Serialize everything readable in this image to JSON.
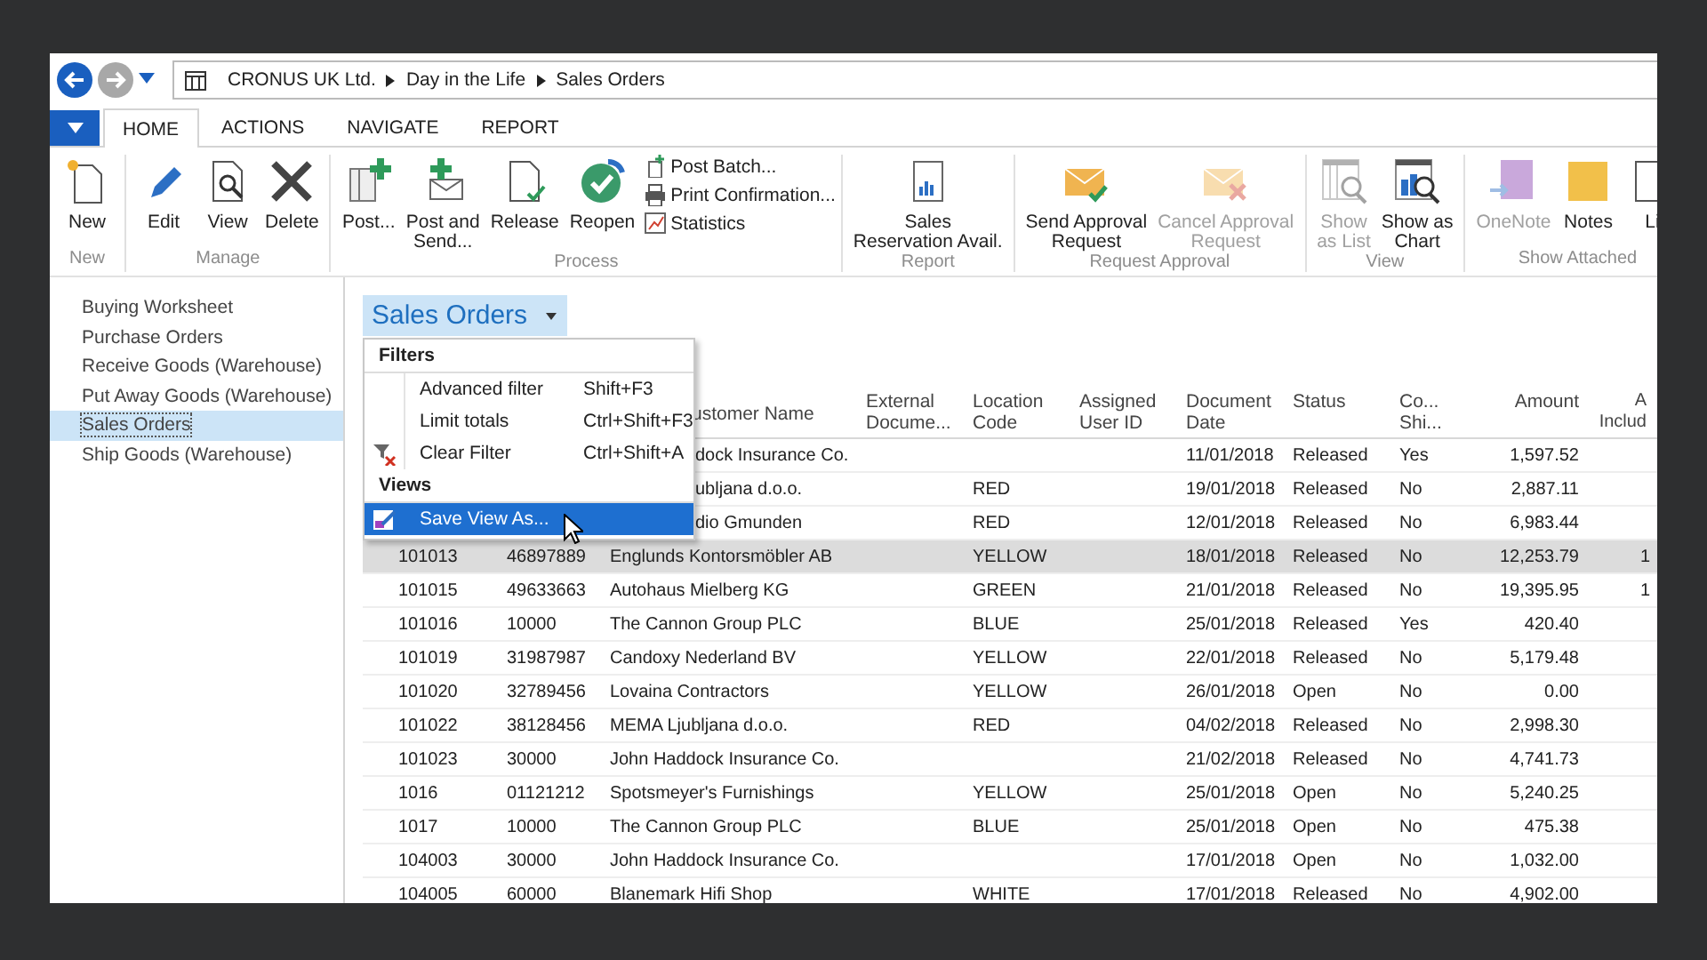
{
  "address_bar": {
    "breadcrumb": [
      "CRONUS UK Ltd.",
      "Day in the Life",
      "Sales Orders"
    ]
  },
  "ribbon_tabs": [
    {
      "label": "HOME",
      "selected": true
    },
    {
      "label": "ACTIONS",
      "selected": false
    },
    {
      "label": "NAVIGATE",
      "selected": false
    },
    {
      "label": "REPORT",
      "selected": false
    }
  ],
  "ribbon_groups": [
    {
      "label": "New",
      "buttons": [
        {
          "kind": "new",
          "lines": [
            "New"
          ],
          "disabled": false
        }
      ]
    },
    {
      "label": "Manage",
      "buttons": [
        {
          "kind": "edit",
          "lines": [
            "Edit"
          ],
          "disabled": false
        },
        {
          "kind": "view",
          "lines": [
            "View"
          ],
          "disabled": false
        },
        {
          "kind": "delete",
          "lines": [
            "Delete"
          ],
          "disabled": false
        }
      ]
    },
    {
      "label": "Process",
      "buttons": [
        {
          "kind": "post",
          "lines": [
            "Post..."
          ],
          "disabled": false
        },
        {
          "kind": "postsend",
          "lines": [
            "Post and",
            "Send..."
          ],
          "disabled": false
        },
        {
          "kind": "release",
          "lines": [
            "Release"
          ],
          "disabled": false
        },
        {
          "kind": "reopen",
          "lines": [
            "Reopen"
          ],
          "disabled": false
        }
      ],
      "small": [
        {
          "kind": "batch",
          "label": "Post Batch..."
        },
        {
          "kind": "print",
          "label": "Print Confirmation..."
        },
        {
          "kind": "statistics",
          "label": "Statistics"
        }
      ]
    },
    {
      "label": "Report",
      "buttons": [
        {
          "kind": "report",
          "lines": [
            "Sales",
            "Reservation Avail."
          ],
          "disabled": false
        }
      ]
    },
    {
      "label": "Request Approval",
      "buttons": [
        {
          "kind": "sendapproval",
          "lines": [
            "Send Approval",
            "Request"
          ],
          "disabled": false
        },
        {
          "kind": "cancelapproval",
          "lines": [
            "Cancel Approval",
            "Request"
          ],
          "disabled": true
        }
      ]
    },
    {
      "label": "View",
      "buttons": [
        {
          "kind": "list",
          "lines": [
            "Show",
            "as List"
          ],
          "disabled": true
        },
        {
          "kind": "chart",
          "lines": [
            "Show as",
            "Chart"
          ],
          "disabled": false
        }
      ]
    },
    {
      "label": "Show Attached",
      "buttons": [
        {
          "kind": "onenote",
          "lines": [
            "OneNote"
          ],
          "disabled": true
        },
        {
          "kind": "notes",
          "lines": [
            "Notes"
          ],
          "disabled": false
        },
        {
          "kind": "links",
          "lines": [
            "Li"
          ],
          "disabled": false
        }
      ]
    }
  ],
  "sidebar": {
    "items": [
      {
        "label": "Buying Worksheet",
        "selected": false
      },
      {
        "label": "Purchase Orders",
        "selected": false
      },
      {
        "label": "Receive Goods (Warehouse)",
        "selected": false
      },
      {
        "label": "Put Away Goods (Warehouse)",
        "selected": false
      },
      {
        "label": "Sales Orders",
        "selected": true
      },
      {
        "label": "Ship Goods (Warehouse)",
        "selected": false
      }
    ]
  },
  "page_title": "Sales Orders",
  "menu": {
    "items": [
      {
        "kind": "header",
        "label": "Filters"
      },
      {
        "kind": "item",
        "label": "Advanced filter",
        "shortcut": "Shift+F3",
        "selected": false
      },
      {
        "kind": "item",
        "label": "Limit totals",
        "shortcut": "Ctrl+Shift+F3",
        "selected": false
      },
      {
        "kind": "clear",
        "label": "Clear Filter",
        "shortcut": "Ctrl+Shift+A",
        "selected": false
      },
      {
        "kind": "header",
        "label": "Views"
      },
      {
        "kind": "save",
        "label": "Save View As...",
        "selected": true
      }
    ]
  },
  "table": {
    "columns": [
      {
        "kind": "partial",
        "lines": [
          "ustomer Name"
        ]
      },
      {
        "kind": "text",
        "lines": [
          "External",
          "Docume..."
        ]
      },
      {
        "kind": "text",
        "lines": [
          "Location",
          "Code"
        ]
      },
      {
        "kind": "text",
        "lines": [
          "Assigned",
          "User ID"
        ]
      },
      {
        "kind": "text",
        "lines": [
          "Document",
          "Date"
        ]
      },
      {
        "kind": "text",
        "lines": [
          "Status"
        ]
      },
      {
        "kind": "text",
        "lines": [
          "Co...",
          "Shi..."
        ]
      },
      {
        "kind": "number",
        "lines": [
          "Amount"
        ]
      },
      {
        "kind": "number",
        "lines": [
          "A",
          "Includ"
        ]
      }
    ],
    "rows": [
      {
        "kind": "partial",
        "selected": false,
        "name": "dock Insurance Co.",
        "date": "11/01/2018",
        "status": "Released",
        "ship": "Yes",
        "amount": "1,597.52"
      },
      {
        "kind": "partial",
        "selected": false,
        "name": "ubljana d.o.o.",
        "location": "RED",
        "date": "19/01/2018",
        "status": "Released",
        "ship": "No",
        "amount": "2,887.11"
      },
      {
        "kind": "partial",
        "selected": false,
        "name": "dio Gmunden",
        "location": "RED",
        "date": "12/01/2018",
        "status": "Released",
        "ship": "No",
        "amount": "6,983.44"
      },
      {
        "kind": "full",
        "selected": true,
        "no": "101013",
        "customer_no": "46897889",
        "name": "Englunds Kontorsmöbler AB",
        "location": "YELLOW",
        "date": "18/01/2018",
        "status": "Released",
        "ship": "No",
        "amount": "12,253.79",
        "column_10": "1"
      },
      {
        "kind": "full",
        "selected": false,
        "no": "101015",
        "customer_no": "49633663",
        "name": "Autohaus Mielberg KG",
        "location": "GREEN",
        "date": "21/01/2018",
        "status": "Released",
        "ship": "No",
        "amount": "19,395.95",
        "column_10": "1"
      },
      {
        "kind": "full",
        "selected": false,
        "no": "101016",
        "customer_no": "10000",
        "name": "The Cannon Group PLC",
        "location": "BLUE",
        "date": "25/01/2018",
        "status": "Released",
        "ship": "Yes",
        "amount": "420.40"
      },
      {
        "kind": "full",
        "selected": false,
        "no": "101019",
        "customer_no": "31987987",
        "name": "Candoxy Nederland BV",
        "location": "YELLOW",
        "date": "22/01/2018",
        "status": "Released",
        "ship": "No",
        "amount": "5,179.48"
      },
      {
        "kind": "full",
        "selected": false,
        "no": "101020",
        "customer_no": "32789456",
        "name": "Lovaina Contractors",
        "location": "YELLOW",
        "date": "26/01/2018",
        "status": "Open",
        "ship": "No",
        "amount": "0.00"
      },
      {
        "kind": "full",
        "selected": false,
        "no": "101022",
        "customer_no": "38128456",
        "name": "MEMA Ljubljana d.o.o.",
        "location": "RED",
        "date": "04/02/2018",
        "status": "Released",
        "ship": "No",
        "amount": "2,998.30"
      },
      {
        "kind": "full",
        "selected": false,
        "no": "101023",
        "customer_no": "30000",
        "name": "John Haddock Insurance Co.",
        "date": "21/02/2018",
        "status": "Released",
        "ship": "No",
        "amount": "4,741.73"
      },
      {
        "kind": "full",
        "selected": false,
        "no": "1016",
        "customer_no": "01121212",
        "name": "Spotsmeyer's Furnishings",
        "location": "YELLOW",
        "date": "25/01/2018",
        "status": "Open",
        "ship": "No",
        "amount": "5,240.25"
      },
      {
        "kind": "full",
        "selected": false,
        "no": "1017",
        "customer_no": "10000",
        "name": "The Cannon Group PLC",
        "location": "BLUE",
        "date": "25/01/2018",
        "status": "Open",
        "ship": "No",
        "amount": "475.38"
      },
      {
        "kind": "full",
        "selected": false,
        "no": "104003",
        "customer_no": "30000",
        "name": "John Haddock Insurance Co.",
        "date": "17/01/2018",
        "status": "Open",
        "ship": "No",
        "amount": "1,032.00"
      },
      {
        "kind": "full",
        "selected": false,
        "no": "104005",
        "customer_no": "60000",
        "name": "Blanemark Hifi Shop",
        "location": "WHITE",
        "date": "17/01/2018",
        "status": "Released",
        "ship": "No",
        "amount": "4,902.00"
      }
    ]
  }
}
